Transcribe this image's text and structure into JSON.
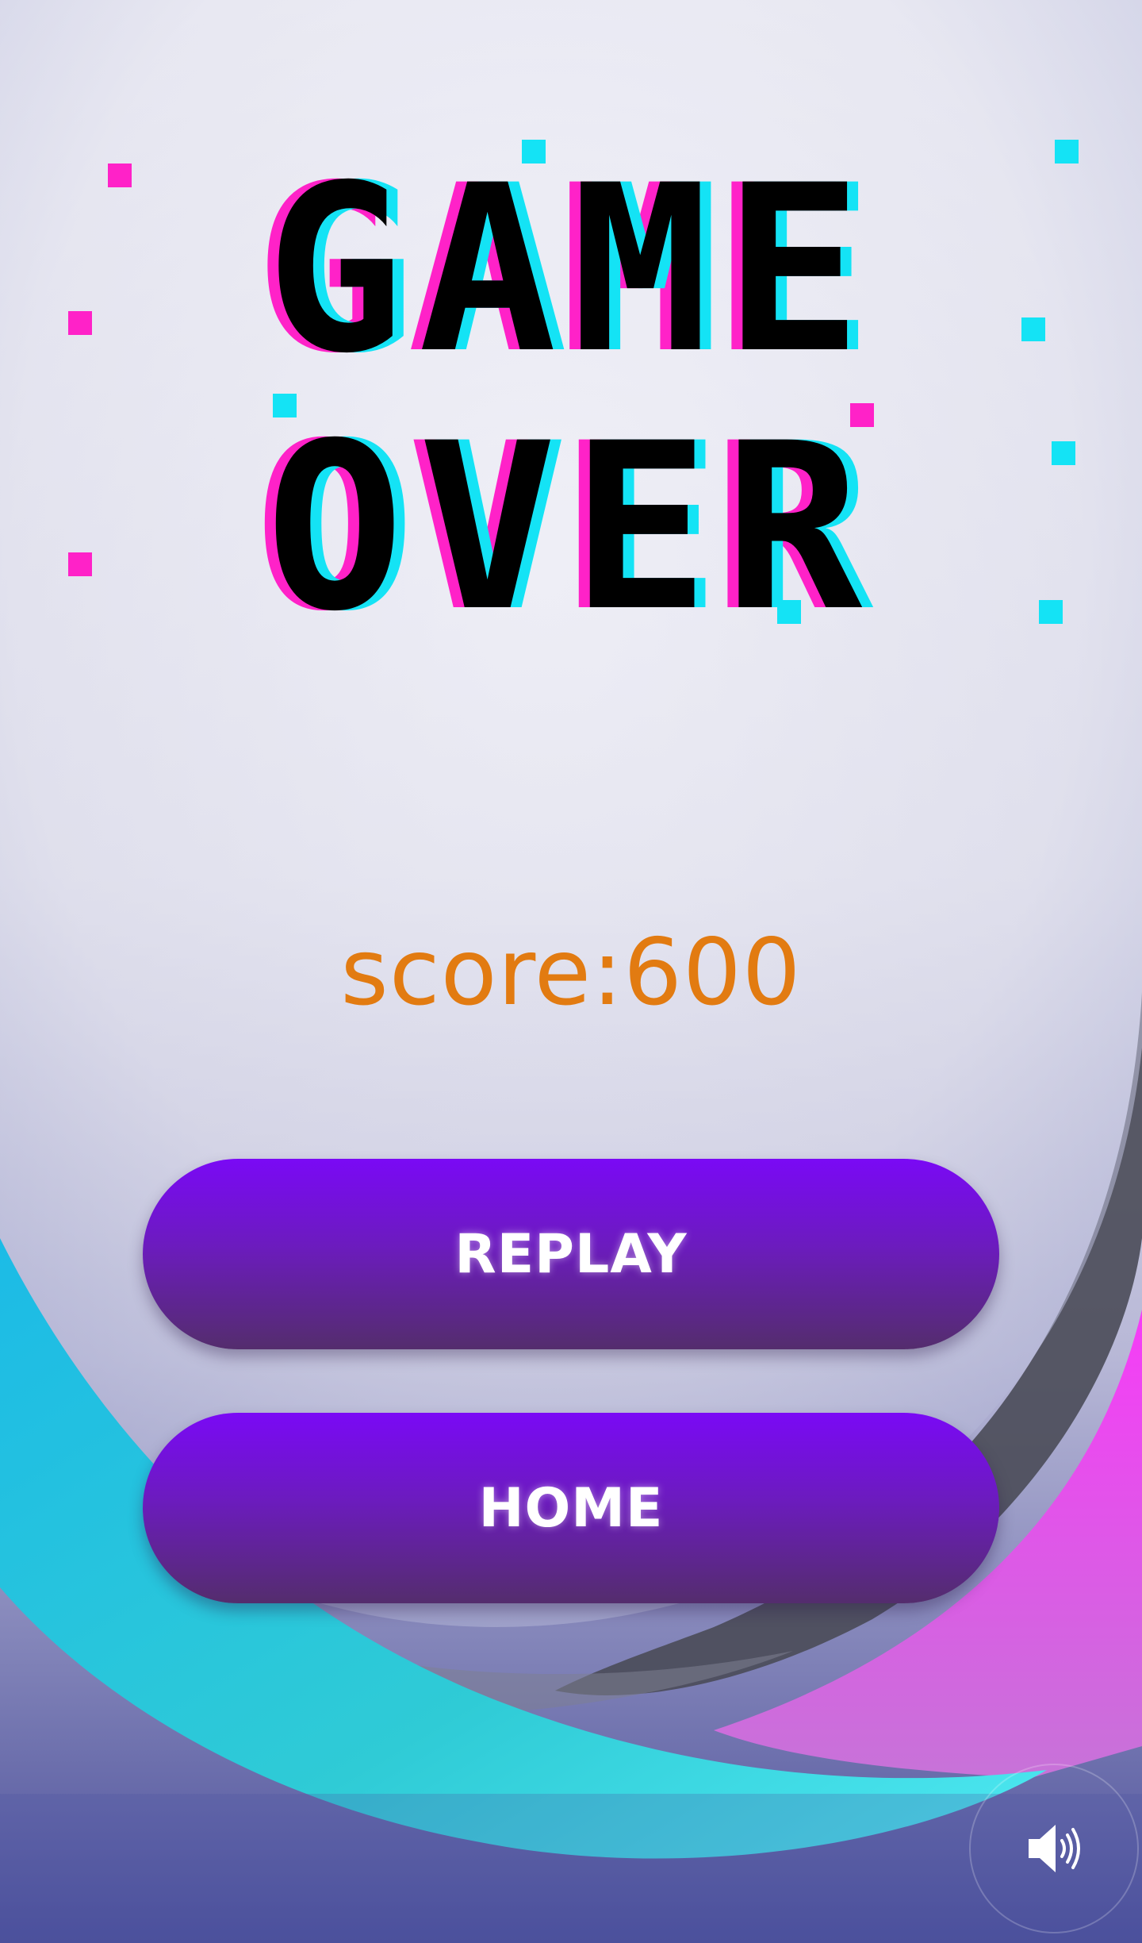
{
  "title_art": "GAME OVER",
  "score_label": "score:600",
  "buttons": {
    "replay": "REPLAY",
    "home": "HOME"
  },
  "sound_icon": "speaker-volume-icon",
  "colors": {
    "score": "#e27b11",
    "button_top": "#7a09f5",
    "button_bottom": "#542d6d",
    "glitch_magenta": "#ff22c8",
    "glitch_cyan": "#14e3f5",
    "swirl_pink": "#f044f4",
    "swirl_cyan": "#20c5e8"
  }
}
